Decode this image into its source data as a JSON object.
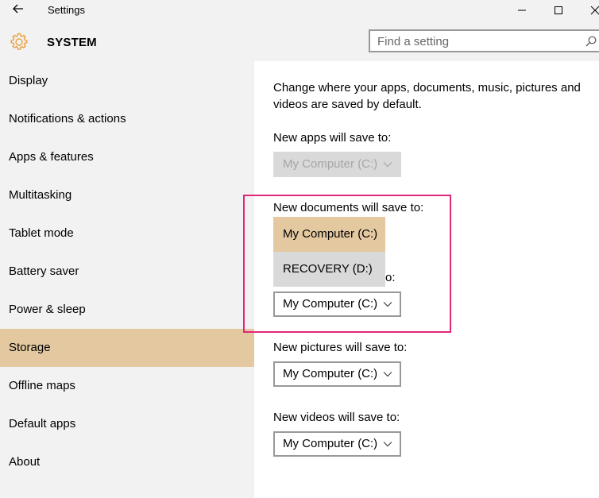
{
  "window": {
    "title": "Settings",
    "icons": {
      "back": "back-arrow-icon",
      "minimize": "minimize-icon",
      "maximize": "maximize-icon",
      "close": "close-icon"
    }
  },
  "header": {
    "section": "SYSTEM",
    "icon": "gear-icon",
    "accent_color": "#e8a040",
    "search": {
      "placeholder": "Find a setting",
      "icon": "search-icon"
    }
  },
  "sidebar": {
    "selected_color": "#e3c8a0",
    "items": [
      {
        "label": "Display"
      },
      {
        "label": "Notifications & actions"
      },
      {
        "label": "Apps & features"
      },
      {
        "label": "Multitasking"
      },
      {
        "label": "Tablet mode"
      },
      {
        "label": "Battery saver"
      },
      {
        "label": "Power & sleep"
      },
      {
        "label": "Storage",
        "selected": true
      },
      {
        "label": "Offline maps"
      },
      {
        "label": "Default apps"
      },
      {
        "label": "About"
      }
    ]
  },
  "main": {
    "description": "Change where your apps, documents, music, pictures and videos are saved by default.",
    "apps": {
      "label": "New apps will save to:",
      "value": "My Computer (C:)",
      "disabled": true
    },
    "documents": {
      "label": "New documents will save to:",
      "open_options": [
        "My Computer (C:)",
        "RECOVERY (D:)"
      ],
      "selected": "My Computer (C:)"
    },
    "music": {
      "label_partial": "o:",
      "value": "My Computer (C:)"
    },
    "pictures": {
      "label": "New pictures will save to:",
      "value": "My Computer (C:)"
    },
    "videos": {
      "label": "New videos will save to:",
      "value": "My Computer (C:)"
    }
  },
  "annotation": {
    "color": "#e0277a"
  }
}
